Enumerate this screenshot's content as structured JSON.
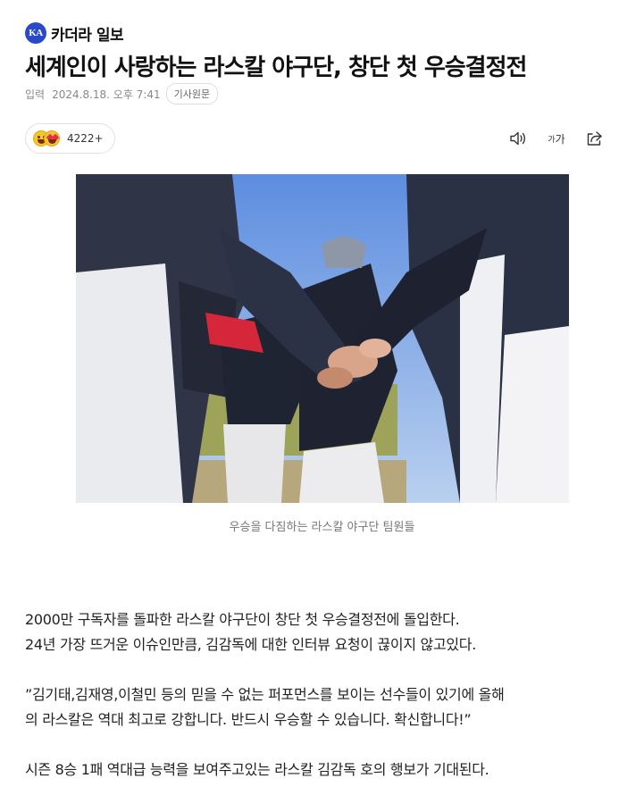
{
  "brand": {
    "logo_text": "KA",
    "name": "카더라 일보",
    "logo_color": "#2a49c8"
  },
  "article": {
    "title": "세계인이 사랑하는 라스칼 야구단, 창단 첫 우승결정전",
    "meta_label": "입력",
    "meta_date": "2024.8.18. 오후 7:41",
    "source_button": "기사원문"
  },
  "reactions": {
    "count": "4222+",
    "icons": [
      "grin-emoji-icon",
      "heart-eyes-emoji-icon"
    ]
  },
  "toolbar": {
    "icons": [
      "speaker-icon",
      "font-size-icon",
      "share-icon"
    ],
    "font_size_label_small": "가",
    "font_size_label_large": "가"
  },
  "photo": {
    "caption": "우승을 다짐하는 라스칼 야구단 팀원들"
  },
  "body": {
    "paragraphs": [
      [
        "2000만 구독자를 돌파한 라스칼 야구단이 창단 첫 우승결정전에 돌입한다.",
        "24년 가장 뜨거운 이슈인만큼, 김감독에 대한 인터뷰 요청이 끊이지 않고있다."
      ],
      [
        "”김기태,김재영,이철민 등의 믿을 수 없는 퍼포먼스를 보이는 선수들이 있기에 올해",
        "의 라스칼은 역대 최고로 강합니다. 반드시 우승할 수 있습니다. 확신합니다!”"
      ],
      [
        "시즌 8승 1패 역대급 능력을 보여주고있는 라스칼 김감독 호의 행보가 기대된다."
      ]
    ]
  }
}
